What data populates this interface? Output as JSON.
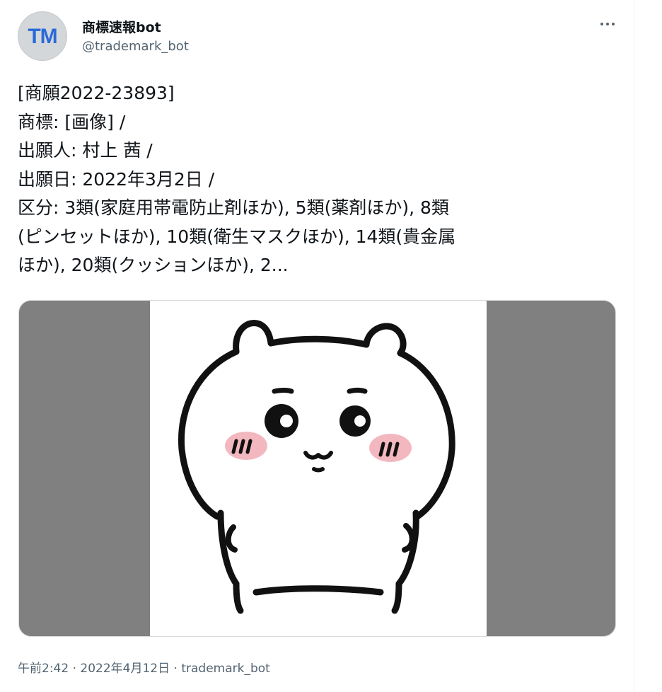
{
  "tweet": {
    "author": {
      "avatar_text": "TM",
      "display_name": "商標速報bot",
      "handle": "@trademark_bot"
    },
    "more_icon": "more-horizontal-icon",
    "text_lines": [
      "[商願2022-23893]",
      "商標: [画像] /",
      "出願人: 村上 茜 /",
      "出願日: 2022年3月2日 /",
      "区分: 3類(家庭用帯電防止剤ほか), 5類(薬剤ほか), 8類",
      "(ピンセットほか), 10類(衛生マスクほか), 14類(貴金属",
      "ほか), 20類(クッションほか), 2..."
    ],
    "media": {
      "background_color": "#808080",
      "image_background": "#ffffff"
    },
    "meta": {
      "time": "午前2:42",
      "separator1": " · ",
      "date": "2022年4月12日",
      "separator2": " · ",
      "source": "trademark_bot"
    }
  }
}
